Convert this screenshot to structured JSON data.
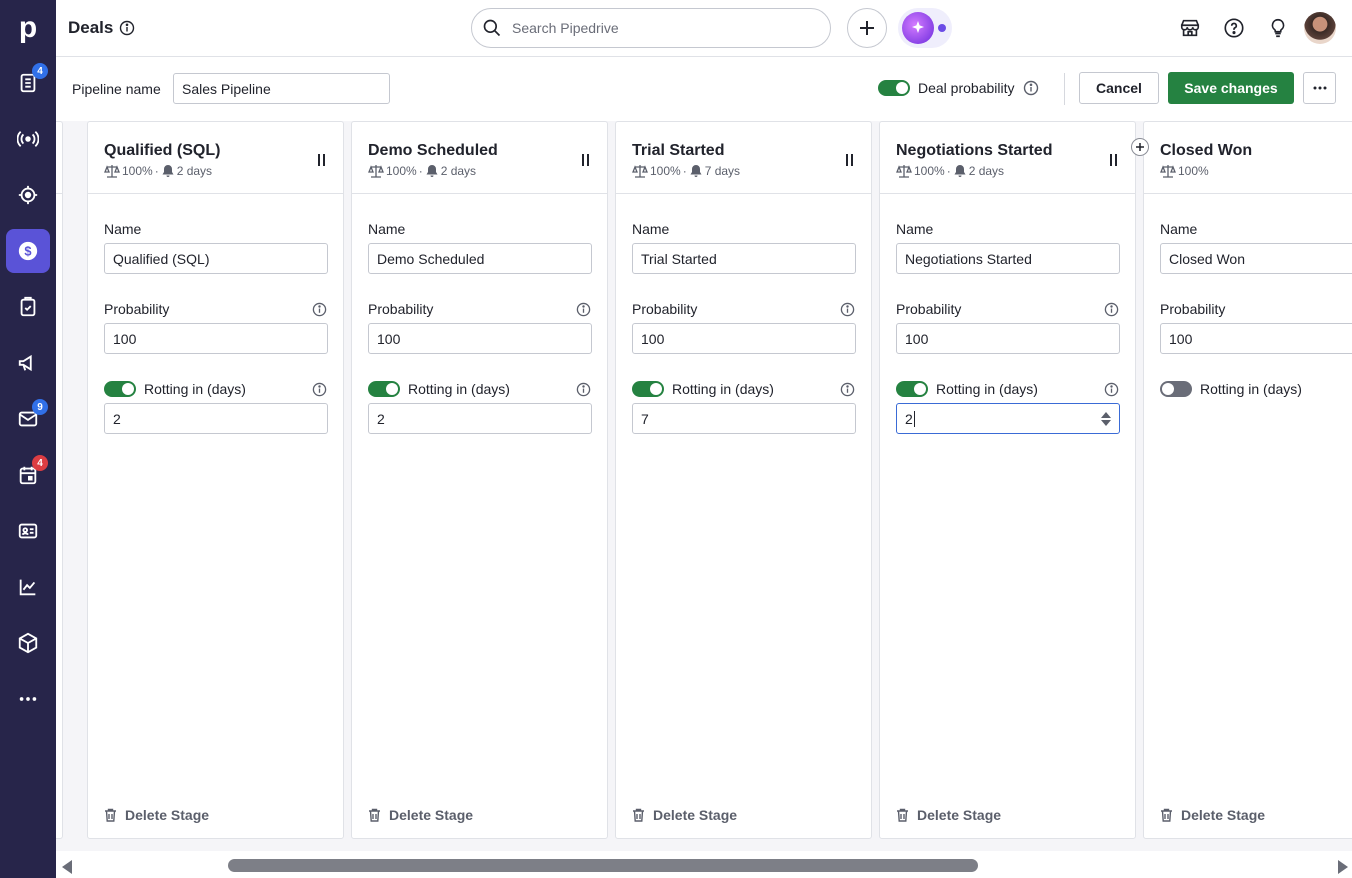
{
  "app": {
    "logo": "p",
    "title": "Deals",
    "search_placeholder": "Search Pipedrive"
  },
  "sidebar": {
    "items": [
      {
        "icon": "leads-icon",
        "badge": "4",
        "badge_color": "#3170e8"
      },
      {
        "icon": "broadcast-icon"
      },
      {
        "icon": "target-icon"
      },
      {
        "icon": "deals-dollar-icon",
        "active": true
      },
      {
        "icon": "activities-icon"
      },
      {
        "icon": "campaigns-megaphone-icon"
      },
      {
        "icon": "mail-icon",
        "badge": "9",
        "badge_color": "#3170e8"
      },
      {
        "icon": "calendar-icon",
        "badge": "4",
        "badge_color": "#dc3d43"
      },
      {
        "icon": "contacts-icon"
      },
      {
        "icon": "insights-chart-icon"
      },
      {
        "icon": "products-box-icon"
      },
      {
        "icon": "more-icon"
      }
    ]
  },
  "pipeline": {
    "name_label": "Pipeline name",
    "name_value": "Sales Pipeline",
    "deal_probability_label": "Deal probability",
    "deal_probability_on": true,
    "cancel_label": "Cancel",
    "save_label": "Save changes",
    "more_label": "···"
  },
  "stage_labels": {
    "name": "Name",
    "probability": "Probability",
    "rotting": "Rotting in (days)",
    "delete": "Delete Stage"
  },
  "stages": [
    {
      "title": "Qualified (SQL)",
      "meta_prob": "100%",
      "meta_days": "2 days",
      "name": "Qualified (SQL)",
      "probability": "100",
      "rotting_on": true,
      "rotting_days": "2"
    },
    {
      "title": "Demo Scheduled",
      "meta_prob": "100%",
      "meta_days": "2 days",
      "name": "Demo Scheduled",
      "probability": "100",
      "rotting_on": true,
      "rotting_days": "2"
    },
    {
      "title": "Trial Started",
      "meta_prob": "100%",
      "meta_days": "7 days",
      "name": "Trial Started",
      "probability": "100",
      "rotting_on": true,
      "rotting_days": "7"
    },
    {
      "title": "Negotiations Started",
      "meta_prob": "100%",
      "meta_days": "2 days",
      "name": "Negotiations Started",
      "probability": "100",
      "rotting_on": true,
      "rotting_days": "2",
      "focused": true
    },
    {
      "title": "Closed Won",
      "meta_prob": "100%",
      "name": "Closed Won",
      "probability": "100",
      "rotting_on": false
    }
  ],
  "colors": {
    "sidebar_bg": "#27254a",
    "active_nav": "#5a53d7",
    "accent_green": "#258241",
    "focus_blue": "#3a6bd6"
  }
}
